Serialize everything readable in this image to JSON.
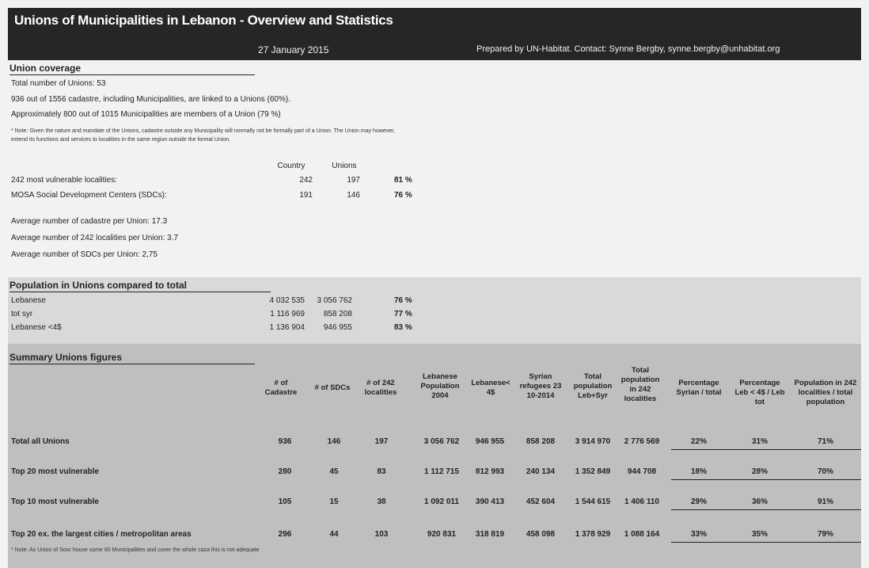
{
  "header": {
    "title": "Unions of Municipalities in Lebanon - Overview and Statistics",
    "date": "27 January 2015",
    "prepared_by": "Prepared by UN-Habitat. Contact: Synne Bergby, synne.bergby@unhabitat.org"
  },
  "union_coverage": {
    "title": "Union coverage",
    "line1": "Total number of Unions: 53",
    "line2": "936 out of 1556 cadastre, including Municipalities, are linked to a Unions (60%).",
    "line3": "Approximately 800 out of 1015 Municipalities are members of a Union (79 %)",
    "note1": "* Note: Given the nature and mandate of the Unions, cadastre outside any Municipality will normally not be formally part of a Union. The Union may however,",
    "note2": "extend its functions and services to localities in the same region outside the formal Union.",
    "col_country": "Country",
    "col_unions": "Unions",
    "rows": [
      {
        "label": "242 most vulnerable localities:",
        "country": "242",
        "unions": "197",
        "pct": "81 %"
      },
      {
        "label": "MOSA Social Development Centers (SDCs):",
        "country": "191",
        "unions": "146",
        "pct": "76 %"
      }
    ],
    "avg1": "Average number of cadastre per Union: 17.3",
    "avg2": "Average number of 242 localities per Union: 3.7",
    "avg3": "Average number of SDCs per Union: 2,75"
  },
  "population": {
    "title": "Population in Unions compared to total",
    "rows": [
      {
        "label": "Lebanese",
        "total": "4 032 535",
        "unions": "3 056 762",
        "pct": "76 %"
      },
      {
        "label": "tot syr",
        "total": "1 116 969",
        "unions": "858 208",
        "pct": "77 %"
      },
      {
        "label": "Lebanese <4$",
        "total": "1 136 904",
        "unions": "946 955",
        "pct": "83 %"
      }
    ]
  },
  "summary": {
    "title": "Summary Unions figures",
    "headers": [
      "# of Cadastre",
      "# of SDCs",
      "# of 242 localities",
      "Lebanese Population 2004",
      "Lebanese< 4$",
      "Syrian refugees 23 10-2014",
      "Total population Leb+Syr",
      "Total population in 242 localities",
      "Percentage Syrian / total",
      "Percentage Leb < 4$ / Leb tot",
      "Population in 242 localities / total population"
    ],
    "rows": [
      {
        "label": "Total all Unions",
        "cells": [
          "936",
          "146",
          "197",
          "3 056 762",
          "946 955",
          "858 208",
          "3 914 970",
          "2 776 569",
          "22%",
          "31%",
          "71%"
        ]
      },
      {
        "label": "Top 20 most vulnerable",
        "cells": [
          "280",
          "45",
          "83",
          "1 112 715",
          "812 993",
          "240 134",
          "1 352 849",
          "944 708",
          "18%",
          "28%",
          "70%"
        ]
      },
      {
        "label": "Top 10 most vulnerable",
        "cells": [
          "105",
          "15",
          "38",
          "1 092 011",
          "390 413",
          "452 604",
          "1 544 615",
          "1 406 110",
          "29%",
          "36%",
          "91%"
        ]
      },
      {
        "label": "Top 20 ex. the largest cities / metropolitan areas",
        "cells": [
          "296",
          "44",
          "103",
          "920 831",
          "318 819",
          "458 098",
          "1 378 929",
          "1 088 164",
          "33%",
          "35%",
          "79%"
        ]
      }
    ],
    "footnote": "* Note: As Union of Sour house some 60 Municipalities and cover the whole caza this is not adequate"
  }
}
